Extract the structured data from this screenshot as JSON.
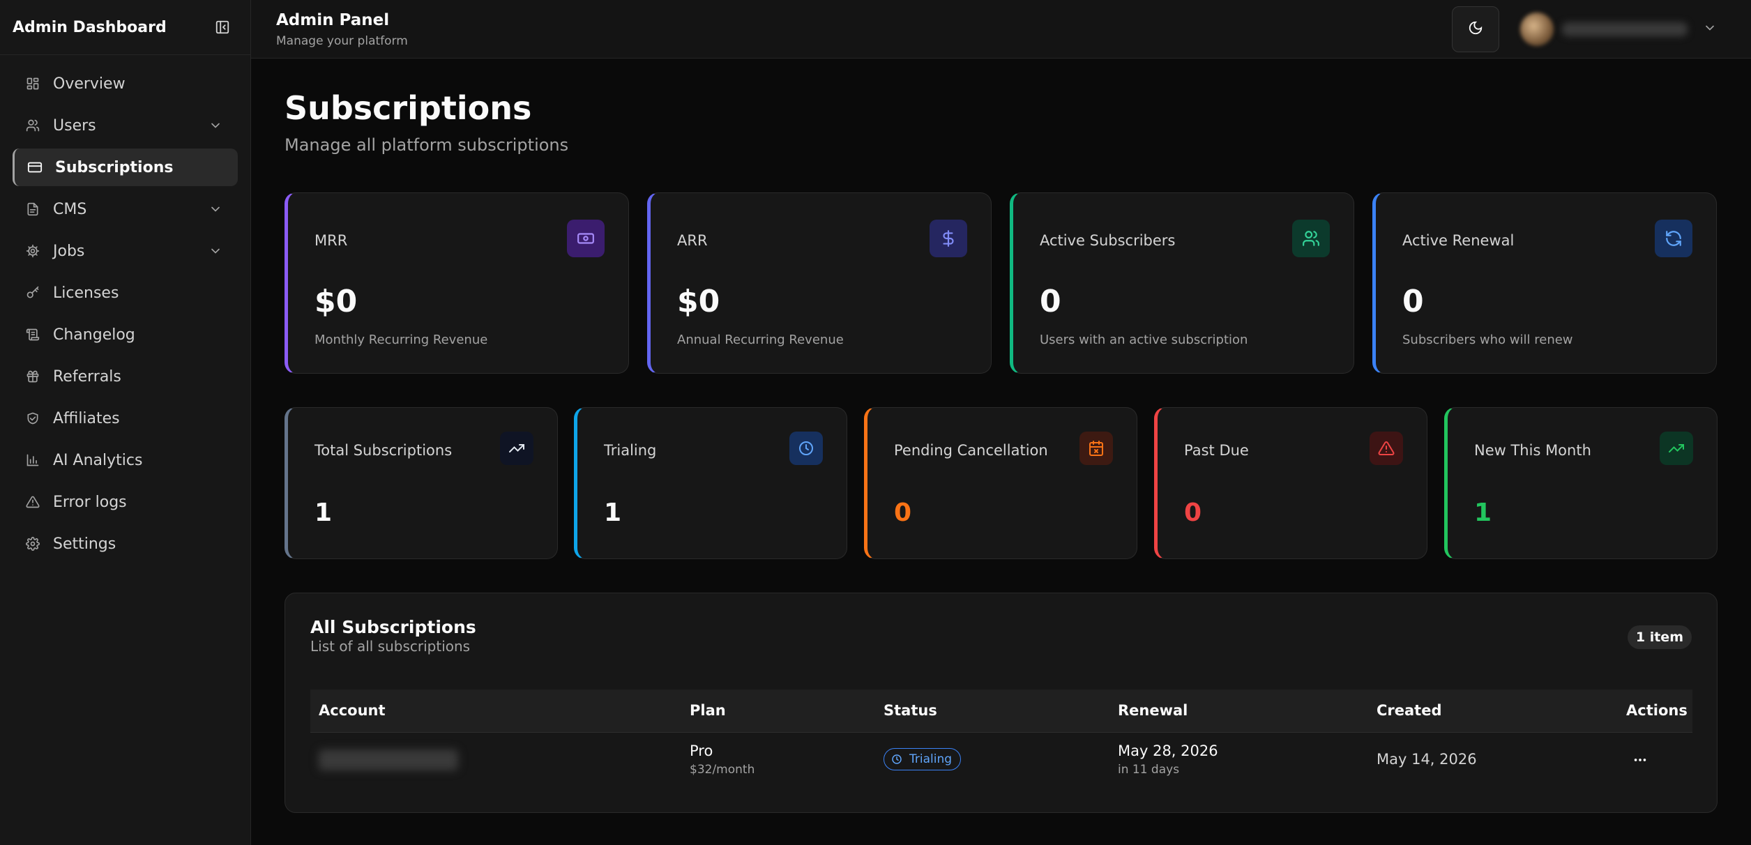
{
  "sidebar": {
    "brand": "Admin Dashboard",
    "items": [
      {
        "label": "Overview",
        "icon": "grid-icon",
        "active": false,
        "expandable": false
      },
      {
        "label": "Users",
        "icon": "users-icon",
        "active": false,
        "expandable": true
      },
      {
        "label": "Subscriptions",
        "icon": "credit-card-icon",
        "active": true,
        "expandable": false
      },
      {
        "label": "CMS",
        "icon": "file-text-icon",
        "active": false,
        "expandable": true
      },
      {
        "label": "Jobs",
        "icon": "cog-icon",
        "active": false,
        "expandable": true
      },
      {
        "label": "Licenses",
        "icon": "key-icon",
        "active": false,
        "expandable": false
      },
      {
        "label": "Changelog",
        "icon": "scroll-icon",
        "active": false,
        "expandable": false
      },
      {
        "label": "Referrals",
        "icon": "gift-icon",
        "active": false,
        "expandable": false
      },
      {
        "label": "Affiliates",
        "icon": "handshake-icon",
        "active": false,
        "expandable": false
      },
      {
        "label": "AI Analytics",
        "icon": "bar-chart-icon",
        "active": false,
        "expandable": false
      },
      {
        "label": "Error logs",
        "icon": "alert-triangle-icon",
        "active": false,
        "expandable": false
      },
      {
        "label": "Settings",
        "icon": "settings-icon",
        "active": false,
        "expandable": false
      }
    ]
  },
  "topbar": {
    "title": "Admin Panel",
    "subtitle": "Manage your platform"
  },
  "page": {
    "title": "Subscriptions",
    "subtitle": "Manage all platform subscriptions"
  },
  "stats_primary": [
    {
      "label": "MRR",
      "value": "$0",
      "desc": "Monthly Recurring Revenue",
      "icon": "banknote-icon",
      "accent": "#8b5cf6"
    },
    {
      "label": "ARR",
      "value": "$0",
      "desc": "Annual Recurring Revenue",
      "icon": "dollar-icon",
      "accent": "#6366f1"
    },
    {
      "label": "Active Subscribers",
      "value": "0",
      "desc": "Users with an active subscription",
      "icon": "users-icon",
      "accent": "#10b981"
    },
    {
      "label": "Active Renewal",
      "value": "0",
      "desc": "Subscribers who will renew",
      "icon": "refresh-icon",
      "accent": "#3b82f6"
    }
  ],
  "stats_secondary": [
    {
      "label": "Total Subscriptions",
      "value": "1",
      "icon": "trending-up-icon",
      "accent": "#64748b"
    },
    {
      "label": "Trialing",
      "value": "1",
      "icon": "clock-icon",
      "accent": "#0ea5e9"
    },
    {
      "label": "Pending Cancellation",
      "value": "0",
      "icon": "calendar-x-icon",
      "accent": "#f97316"
    },
    {
      "label": "Past Due",
      "value": "0",
      "icon": "alert-triangle-icon",
      "accent": "#ef4444"
    },
    {
      "label": "New This Month",
      "value": "1",
      "icon": "trending-up-icon",
      "accent": "#22c55e"
    }
  ],
  "table": {
    "title": "All Subscriptions",
    "subtitle": "List of all subscriptions",
    "count_badge": "1 item",
    "columns": [
      "Account",
      "Plan",
      "Status",
      "Renewal",
      "Created",
      "Actions"
    ],
    "rows": [
      {
        "plan": "Pro",
        "price": "$32/month",
        "status": "Trialing",
        "renewal_date": "May 28, 2026",
        "renewal_relative": "in 11 days",
        "created": "May 14, 2026"
      }
    ]
  }
}
